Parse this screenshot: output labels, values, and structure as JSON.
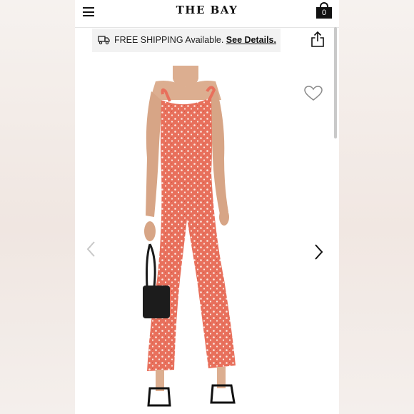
{
  "header": {
    "brand": "THE BAY",
    "menu_icon": "hamburger-menu-icon",
    "bag_icon": "shopping-bag-icon",
    "bag_count": "0"
  },
  "shipping_banner": {
    "icon": "truck-icon",
    "text": "FREE SHIPPING Available.",
    "link": "See Details."
  },
  "actions": {
    "share_icon": "share-icon",
    "wishlist_icon": "heart-icon"
  },
  "carousel": {
    "prev_icon": "chevron-left-icon",
    "next_icon": "chevron-right-icon",
    "image": "product-photo-floral-jumpsuit"
  },
  "colors": {
    "background": "#ffffff",
    "text": "#111111",
    "banner_bg": "#f2f2f2",
    "jumpsuit": "#e9735f"
  }
}
